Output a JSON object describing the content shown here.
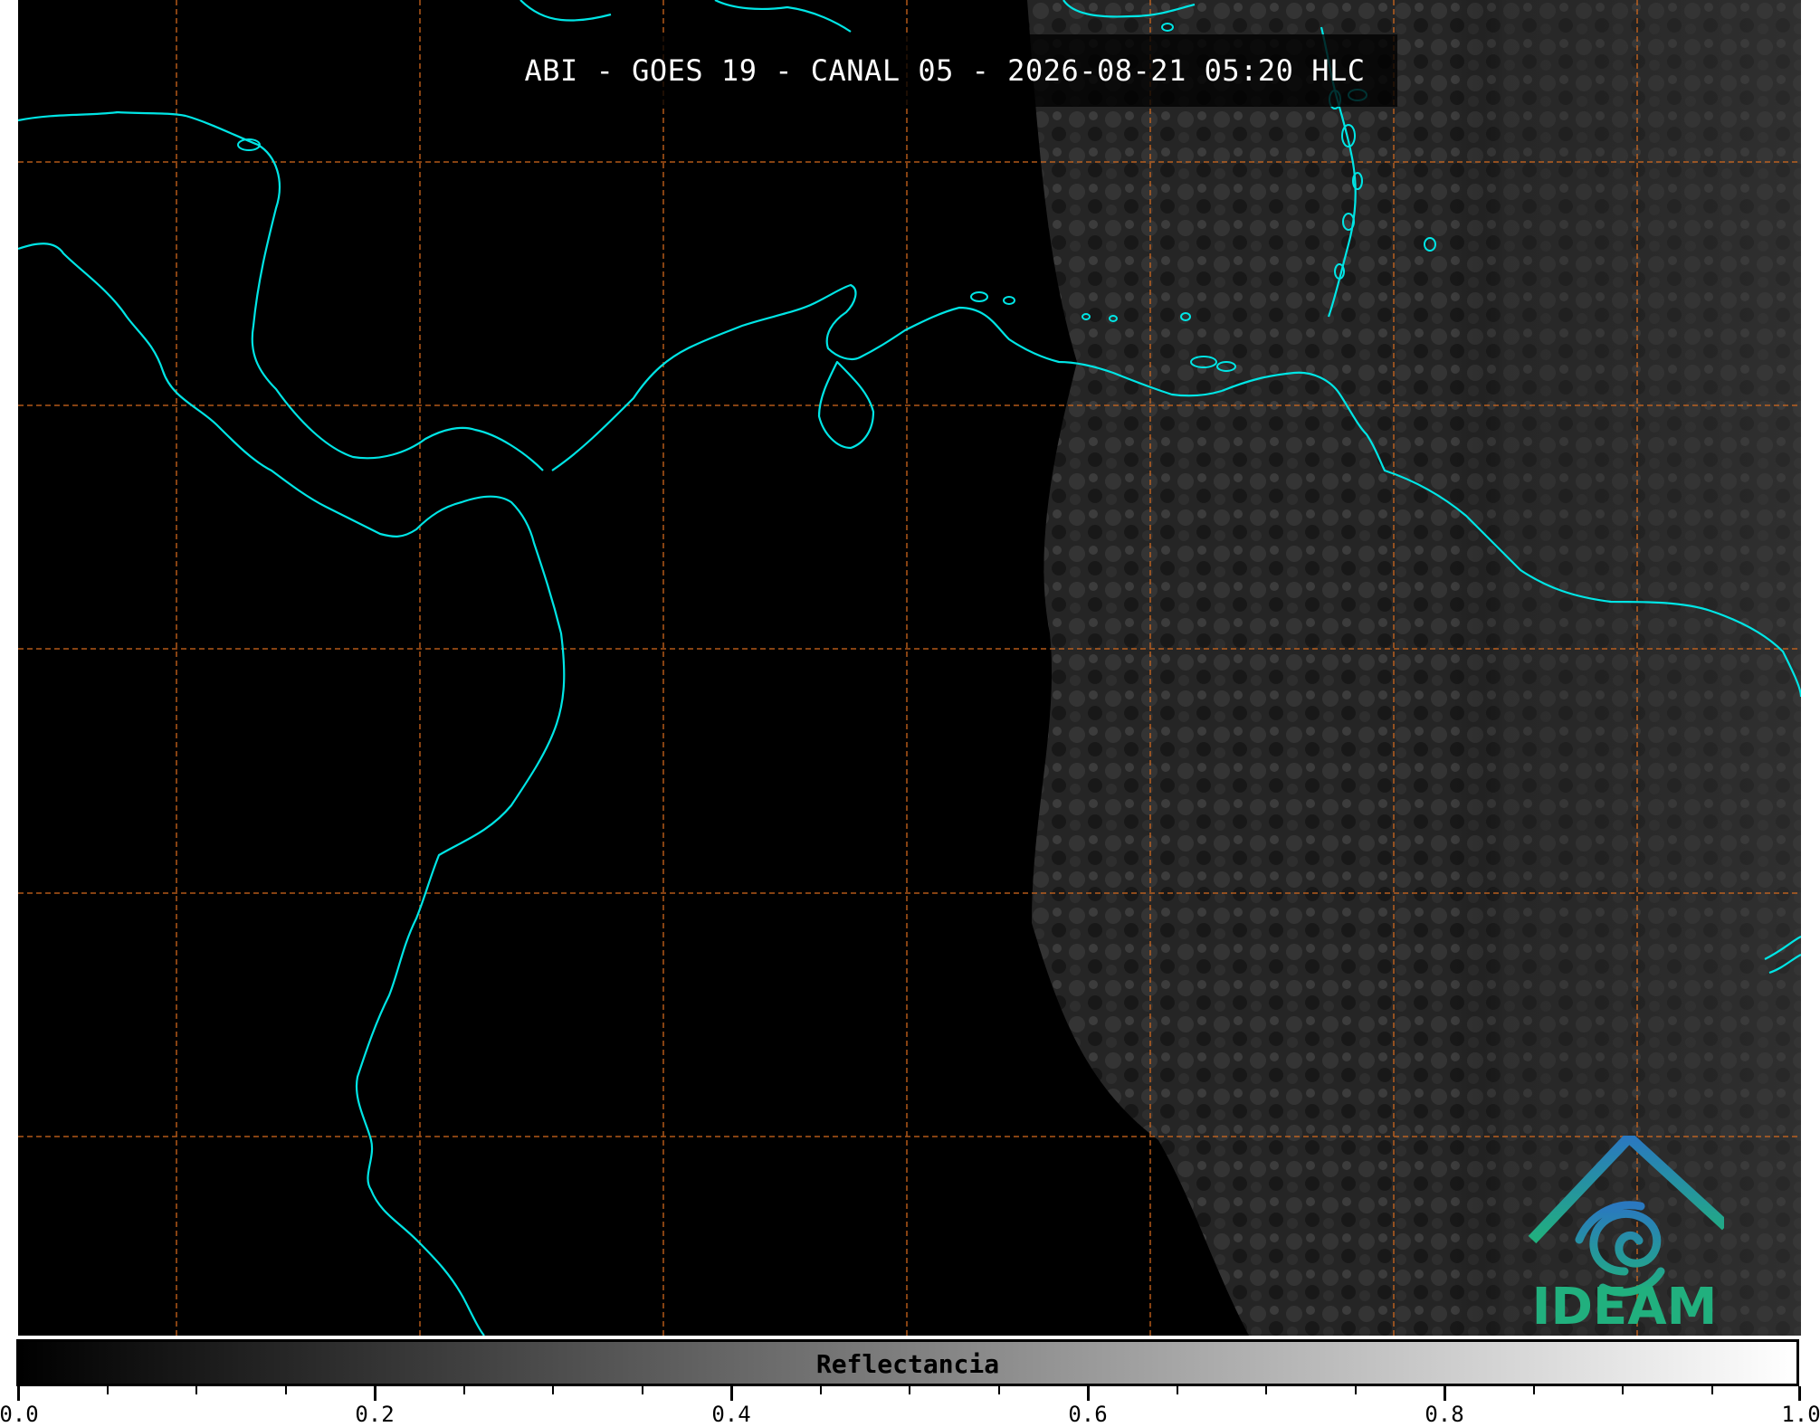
{
  "title": "ABI - GOES 19 - CANAL 05 - 2026-08-21 05:20 HLC",
  "colorbar": {
    "label": "Reflectancia",
    "ticks": [
      "0.0",
      "0.2",
      "0.4",
      "0.6",
      "0.8",
      "1.0"
    ],
    "min": 0.0,
    "max": 1.0,
    "colormap": "grayscale"
  },
  "logo": {
    "text": "IDEAM"
  },
  "colors": {
    "coastline": "#00e5e5",
    "gridlines": "#d2691e",
    "background": "#000000",
    "logo_blue": "#2a78c0",
    "logo_green": "#21b07e"
  },
  "gridlines": {
    "style": "dashed"
  }
}
